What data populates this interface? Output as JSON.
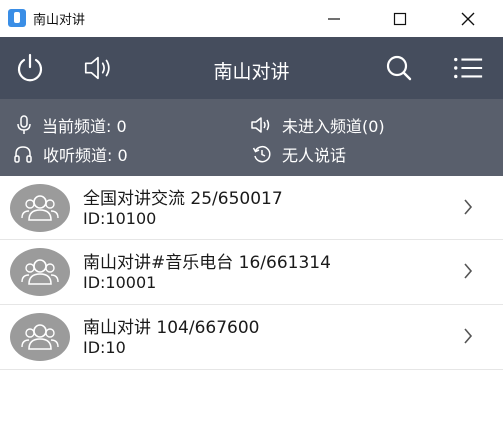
{
  "window": {
    "title": "南山对讲"
  },
  "toolbar": {
    "title": "南山对讲"
  },
  "status": {
    "current_channel": "当前频道: 0",
    "listen_channel": "收听频道: 0",
    "not_in_channel": "未进入频道(0)",
    "nobody_speaking": "无人说话"
  },
  "channels": [
    {
      "title": "全国对讲交流 25/650017",
      "id": "ID:10100"
    },
    {
      "title": "南山对讲#音乐电台 16/661314",
      "id": "ID:10001"
    },
    {
      "title": "南山对讲 104/667600",
      "id": "ID:10"
    }
  ],
  "colors": {
    "toolbar": "#454d5d",
    "status_bar": "#595f6c",
    "avatar": "#9b9b9b"
  }
}
